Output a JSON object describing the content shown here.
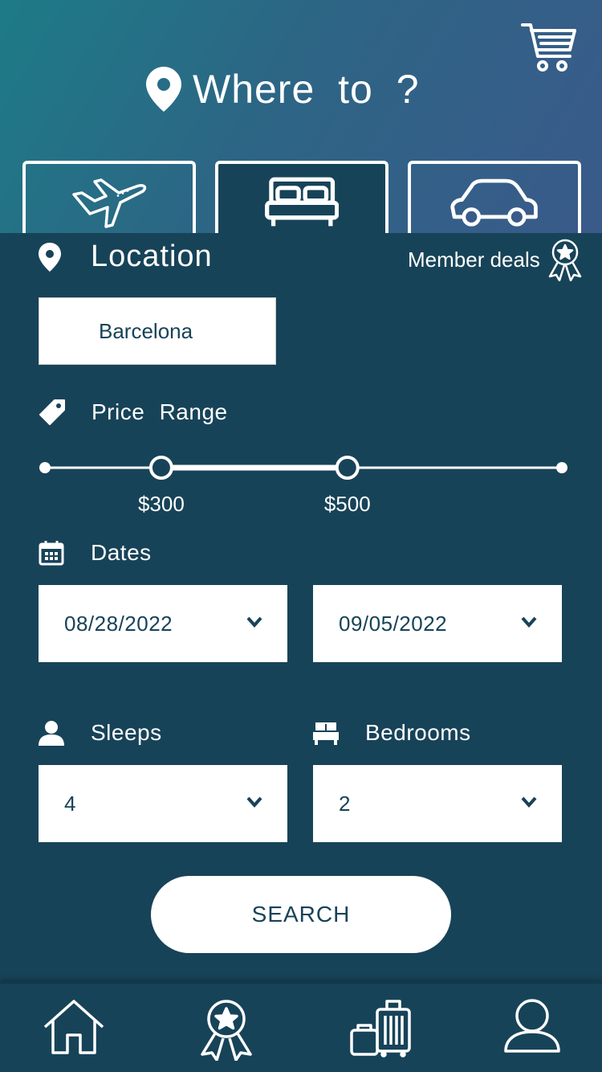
{
  "header": {
    "title": "Where to?",
    "title_display": "Where  to ?"
  },
  "tabs": [
    {
      "name": "flights",
      "icon": "airplane-icon"
    },
    {
      "name": "stays",
      "icon": "bed-icon",
      "active": true
    },
    {
      "name": "cars",
      "icon": "car-icon"
    }
  ],
  "location": {
    "label": "Location",
    "value": "Barcelona",
    "member_deals": "Member deals"
  },
  "price": {
    "label": "Price  Range",
    "min_label": "$300",
    "max_label": "$500",
    "min_fraction": 0.225,
    "max_fraction": 0.585
  },
  "dates": {
    "label": "Dates",
    "start": "08/28/2022",
    "end": "09/05/2022"
  },
  "sleeps": {
    "label": "Sleeps",
    "value": "4"
  },
  "bedrooms": {
    "label": "Bedrooms",
    "value": "2"
  },
  "search": {
    "label": "SEARCH"
  },
  "nav": [
    "home-icon",
    "award-icon",
    "luggage-icon",
    "profile-icon"
  ],
  "colors": {
    "panel": "#174358",
    "accent": "#ffffff"
  }
}
